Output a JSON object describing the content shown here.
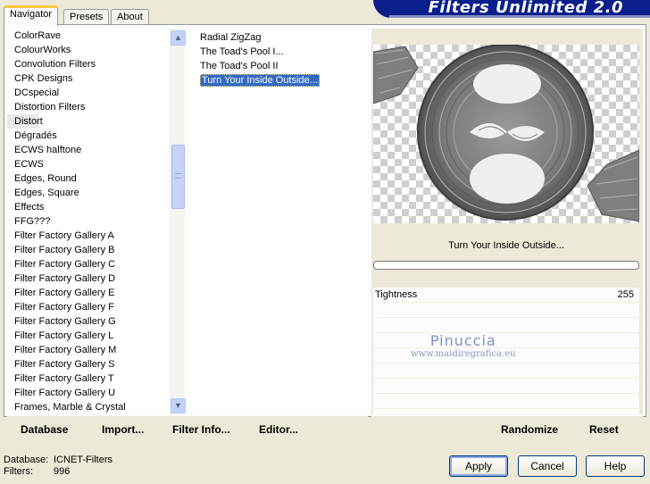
{
  "tabs": [
    "Navigator",
    "Presets",
    "About"
  ],
  "banner": "Filters Unlimited 2.0",
  "categories": [
    "ColorRave",
    "ColourWorks",
    "Convolution Filters",
    "CPK Designs",
    "DCspecial",
    "Distortion Filters",
    "Distort",
    "Dégradés",
    "ECWS halftone",
    "ECWS",
    "Edges, Round",
    "Edges, Square",
    "Effects",
    "FFG???",
    "Filter Factory Gallery A",
    "Filter Factory Gallery B",
    "Filter Factory Gallery C",
    "Filter Factory Gallery D",
    "Filter Factory Gallery E",
    "Filter Factory Gallery F",
    "Filter Factory Gallery G",
    "Filter Factory Gallery L",
    "Filter Factory Gallery M",
    "Filter Factory Gallery S",
    "Filter Factory Gallery T",
    "Filter Factory Gallery U",
    "Frames, Marble & Crystal"
  ],
  "selected_category": "Distort",
  "filters": [
    "Radial ZigZag",
    "The Toad's Pool I...",
    "The Toad's Pool II",
    "Turn Your Inside Outside..."
  ],
  "selected_filter": "Turn Your Inside Outside...",
  "preview": {
    "filter_name": "Turn Your Inside Outside..."
  },
  "params": [
    {
      "label": "Tightness",
      "value": "255"
    }
  ],
  "watermark": {
    "line1": "Pinuccia",
    "line2": "www.maidiregrafica.eu"
  },
  "links": {
    "database": "Database",
    "import": "Import...",
    "filter_info": "Filter Info...",
    "editor": "Editor...",
    "randomize": "Randomize",
    "reset": "Reset"
  },
  "status": {
    "database_label": "Database:",
    "database_value": "ICNET-Filters",
    "filters_label": "Filters:",
    "filters_value": "996"
  },
  "buttons": {
    "apply": "Apply",
    "cancel": "Cancel",
    "help": "Help"
  },
  "colors": {
    "banner": "#0a1e8c",
    "selection": "#316ac5"
  },
  "icons": {
    "scroll_up": "▲",
    "scroll_down": "▼"
  }
}
